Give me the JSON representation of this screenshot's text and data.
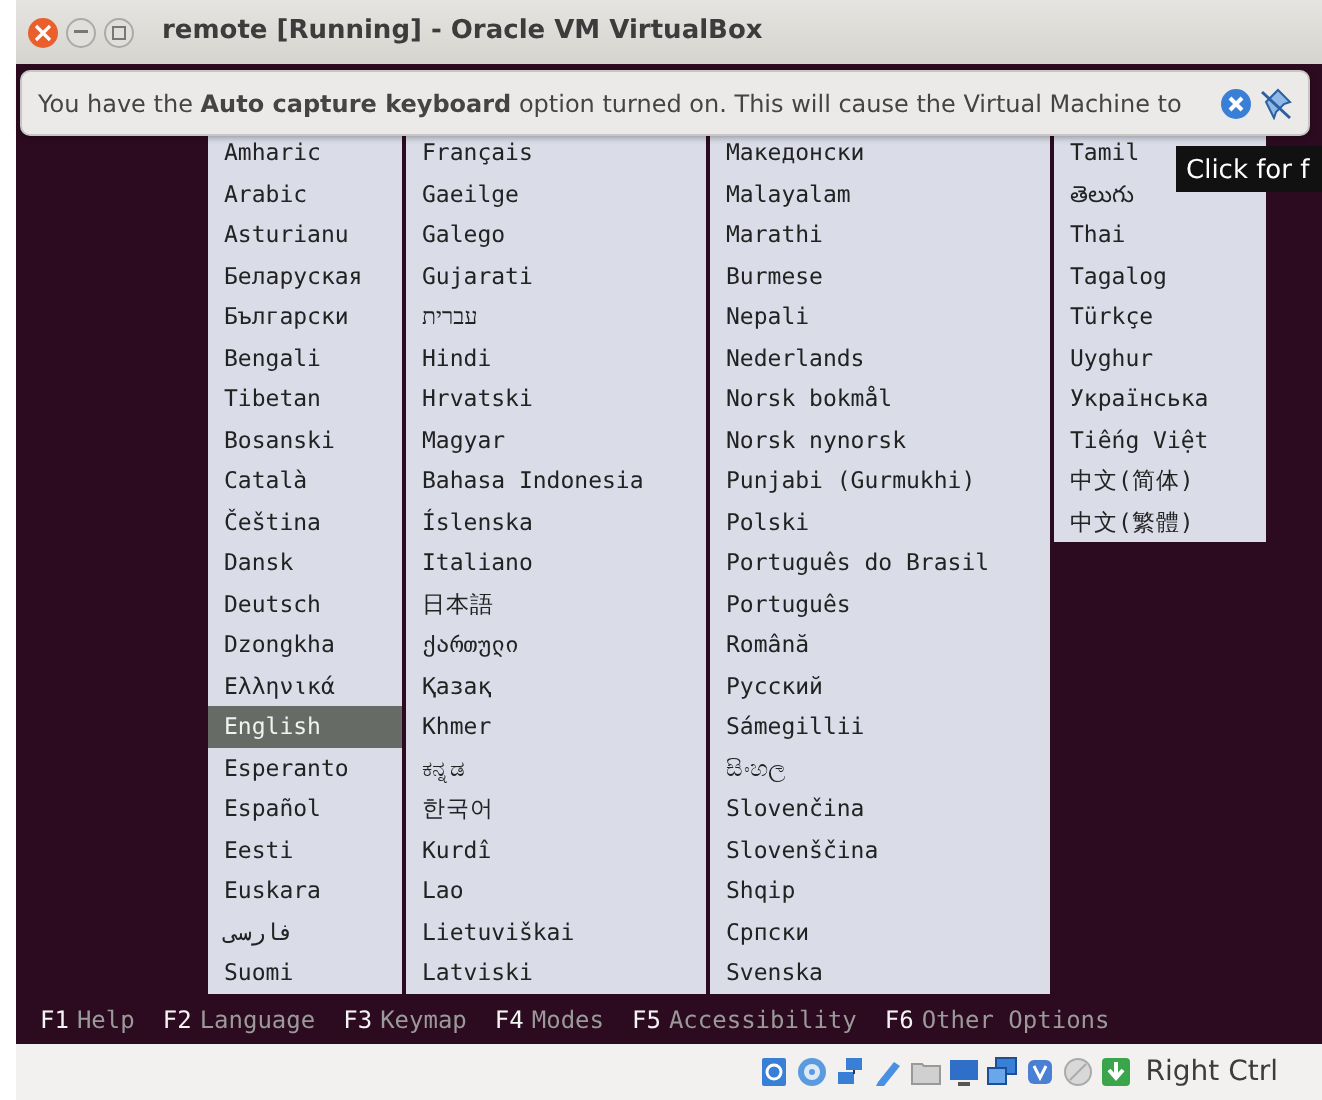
{
  "window": {
    "title": "remote [Running] - Oracle VM VirtualBox"
  },
  "notification": {
    "text": "You have the **Auto capture keyboard** option turned on. This will cause the Virtual Machine to"
  },
  "tooltip": {
    "text": "Click for f"
  },
  "language_menu": {
    "columns": [
      {
        "items": [
          {
            "label": "Amharic",
            "selected": false
          },
          {
            "label": "Arabic",
            "selected": false
          },
          {
            "label": "Asturianu",
            "selected": false
          },
          {
            "label": "Беларуская",
            "selected": false
          },
          {
            "label": "Български",
            "selected": false
          },
          {
            "label": "Bengali",
            "selected": false
          },
          {
            "label": "Tibetan",
            "selected": false
          },
          {
            "label": "Bosanski",
            "selected": false
          },
          {
            "label": "Català",
            "selected": false
          },
          {
            "label": "Čeština",
            "selected": false
          },
          {
            "label": "Dansk",
            "selected": false
          },
          {
            "label": "Deutsch",
            "selected": false
          },
          {
            "label": "Dzongkha",
            "selected": false
          },
          {
            "label": "Ελληνικά",
            "selected": false
          },
          {
            "label": "English",
            "selected": true
          },
          {
            "label": "Esperanto",
            "selected": false
          },
          {
            "label": "Español",
            "selected": false
          },
          {
            "label": "Eesti",
            "selected": false
          },
          {
            "label": "Euskara",
            "selected": false
          },
          {
            "label": "فارسی",
            "selected": false
          },
          {
            "label": "Suomi",
            "selected": false
          }
        ]
      },
      {
        "items": [
          {
            "label": "Français",
            "selected": false
          },
          {
            "label": "Gaeilge",
            "selected": false
          },
          {
            "label": "Galego",
            "selected": false
          },
          {
            "label": "Gujarati",
            "selected": false
          },
          {
            "label": "עברית",
            "selected": false
          },
          {
            "label": "Hindi",
            "selected": false
          },
          {
            "label": "Hrvatski",
            "selected": false
          },
          {
            "label": "Magyar",
            "selected": false
          },
          {
            "label": "Bahasa Indonesia",
            "selected": false
          },
          {
            "label": "Íslenska",
            "selected": false
          },
          {
            "label": "Italiano",
            "selected": false
          },
          {
            "label": "日本語",
            "selected": false
          },
          {
            "label": "ქართული",
            "selected": false
          },
          {
            "label": "Қазақ",
            "selected": false
          },
          {
            "label": "Khmer",
            "selected": false
          },
          {
            "label": "ಕನ್ನಡ",
            "selected": false
          },
          {
            "label": "한국어",
            "selected": false
          },
          {
            "label": "Kurdî",
            "selected": false
          },
          {
            "label": "Lao",
            "selected": false
          },
          {
            "label": "Lietuviškai",
            "selected": false
          },
          {
            "label": "Latviski",
            "selected": false
          }
        ]
      },
      {
        "items": [
          {
            "label": "Македонски",
            "selected": false
          },
          {
            "label": "Malayalam",
            "selected": false
          },
          {
            "label": "Marathi",
            "selected": false
          },
          {
            "label": "Burmese",
            "selected": false
          },
          {
            "label": "Nepali",
            "selected": false
          },
          {
            "label": "Nederlands",
            "selected": false
          },
          {
            "label": "Norsk bokmål",
            "selected": false
          },
          {
            "label": "Norsk nynorsk",
            "selected": false
          },
          {
            "label": "Punjabi (Gurmukhi)",
            "selected": false
          },
          {
            "label": "Polski",
            "selected": false
          },
          {
            "label": "Português do Brasil",
            "selected": false
          },
          {
            "label": "Português",
            "selected": false
          },
          {
            "label": "Română",
            "selected": false
          },
          {
            "label": "Русский",
            "selected": false
          },
          {
            "label": "Sámegillii",
            "selected": false
          },
          {
            "label": "සිංහල",
            "selected": false
          },
          {
            "label": "Slovenčina",
            "selected": false
          },
          {
            "label": "Slovenščina",
            "selected": false
          },
          {
            "label": "Shqip",
            "selected": false
          },
          {
            "label": "Српски",
            "selected": false
          },
          {
            "label": "Svenska",
            "selected": false
          }
        ]
      },
      {
        "items": [
          {
            "label": "Tamil",
            "selected": false
          },
          {
            "label": "తెలుగు",
            "selected": false
          },
          {
            "label": "Thai",
            "selected": false
          },
          {
            "label": "Tagalog",
            "selected": false
          },
          {
            "label": "Türkçe",
            "selected": false
          },
          {
            "label": "Uyghur",
            "selected": false
          },
          {
            "label": "Українська",
            "selected": false
          },
          {
            "label": "Tiếng Việt",
            "selected": false
          },
          {
            "label": "中文(简体)",
            "selected": false
          },
          {
            "label": "中文(繁體)",
            "selected": false
          }
        ]
      }
    ]
  },
  "function_keys": [
    {
      "key": "F1",
      "label": "Help"
    },
    {
      "key": "F2",
      "label": "Language"
    },
    {
      "key": "F3",
      "label": "Keymap"
    },
    {
      "key": "F4",
      "label": "Modes"
    },
    {
      "key": "F5",
      "label": "Accessibility"
    },
    {
      "key": "F6",
      "label": "Other Options"
    }
  ],
  "status_bar": {
    "host_key": "Right Ctrl"
  }
}
